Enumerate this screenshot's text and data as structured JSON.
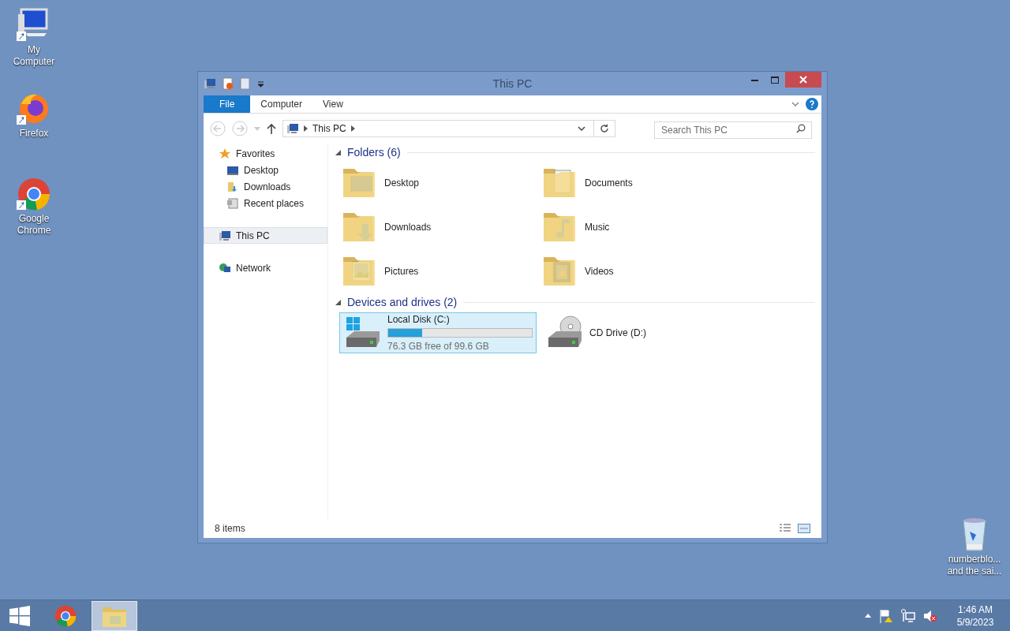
{
  "desktop_icons": [
    {
      "kind": "computer",
      "lines": [
        "My",
        "Computer"
      ]
    },
    {
      "kind": "firefox",
      "lines": [
        "Firefox"
      ]
    },
    {
      "kind": "chrome",
      "lines": [
        "Google",
        "Chrome"
      ]
    },
    {
      "kind": "recycle",
      "lines": [
        "numberblo...",
        "and the sai..."
      ]
    }
  ],
  "window": {
    "title": "This PC",
    "ribbon_tabs": [
      {
        "label": "File",
        "kind": "file"
      },
      {
        "label": "Computer",
        "kind": "tab"
      },
      {
        "label": "View",
        "kind": "tab"
      }
    ],
    "address": {
      "path": [
        "This PC"
      ]
    },
    "search": {
      "placeholder": "Search This PC"
    },
    "navigation": [
      {
        "label": "Favorites",
        "kind": "star",
        "selected": false,
        "children": [
          {
            "label": "Desktop",
            "kind": "desktop",
            "selected": false
          },
          {
            "label": "Downloads",
            "kind": "downloads",
            "selected": false
          },
          {
            "label": "Recent places",
            "kind": "recent",
            "selected": false
          }
        ]
      },
      {
        "label": "This PC",
        "kind": "pc",
        "selected": true
      },
      {
        "label": "Network",
        "kind": "network",
        "selected": false
      }
    ],
    "folders": {
      "heading": "Folders (6)",
      "items": [
        {
          "label": "Desktop",
          "kind": "desktop"
        },
        {
          "label": "Documents",
          "kind": "documents"
        },
        {
          "label": "Downloads",
          "kind": "downloads"
        },
        {
          "label": "Music",
          "kind": "music"
        },
        {
          "label": "Pictures",
          "kind": "pictures"
        },
        {
          "label": "Videos",
          "kind": "videos"
        }
      ]
    },
    "drives": {
      "heading": "Devices and drives (2)",
      "items": [
        {
          "label": "Local Disk (C:)",
          "kind": "disk",
          "selected": true,
          "level": 0.234,
          "free": "76.3 GB free of 99.6 GB"
        },
        {
          "label": "CD Drive (D:)",
          "kind": "cd",
          "selected": false
        }
      ]
    },
    "status_bar": {
      "count": "8 items"
    }
  },
  "taskbar": {
    "buttons": [
      {
        "kind": "chrome",
        "selected": false
      },
      {
        "kind": "explorer",
        "selected": true
      }
    ],
    "time": "1:46 AM",
    "date": "5/9/2023"
  }
}
